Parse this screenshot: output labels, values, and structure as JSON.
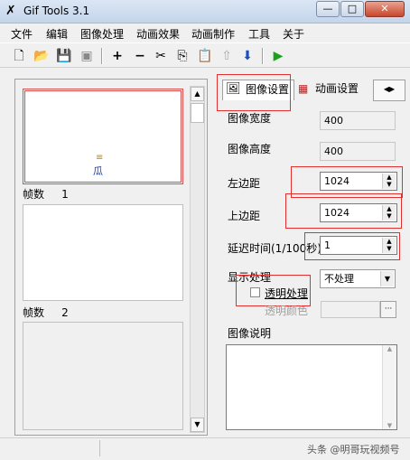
{
  "window": {
    "title": "Gif Tools 3.1",
    "controls": {
      "minimize": "—",
      "maximize": "□",
      "close": "✕"
    }
  },
  "menu": [
    "文件",
    "编辑",
    "图像处理",
    "动画效果",
    "动画制作",
    "工具",
    "关于"
  ],
  "toolbar": {
    "icons": [
      "new-file",
      "open-folder",
      "save",
      "save-copy",
      "add",
      "remove",
      "cut",
      "copy",
      "paste",
      "move-up",
      "move-down",
      "play"
    ],
    "glyphs": [
      "🗋",
      "📂",
      "💾",
      "▣",
      "+",
      "−",
      "✂",
      "⎘",
      "📋",
      "⇧",
      "⬇",
      "▶"
    ]
  },
  "frames": [
    {
      "label": "帧数",
      "number": "1",
      "thumb_text_top": "≡",
      "thumb_text_bottom": "瓜"
    },
    {
      "label": "帧数",
      "number": "2"
    }
  ],
  "tabs": [
    {
      "label": "图像设置",
      "active": true
    },
    {
      "label": "动画设置",
      "active": false
    }
  ],
  "tab_scroll": {
    "left": "◀",
    "right": "▶"
  },
  "form": {
    "width_label": "图像宽度",
    "width_value": "400",
    "height_label": "图像高度",
    "height_value": "400",
    "left_label": "左边距",
    "left_value": "1024",
    "top_label": "上边距",
    "top_value": "1024",
    "delay_label": "延迟时间(1/100秒)",
    "delay_value": "1",
    "display_label": "显示处理",
    "display_value": "不处理",
    "transparent_label": "透明处理",
    "transparent_color_label": "透明颜色",
    "description_label": "图像说明"
  },
  "status": {
    "watermark": "头条 @明哥玩视频号"
  },
  "colors": {
    "highlight": "#e03030",
    "title_bar": "#c4d5ea",
    "play": "#1aa31a",
    "arrow_blue": "#1f4fbf"
  }
}
